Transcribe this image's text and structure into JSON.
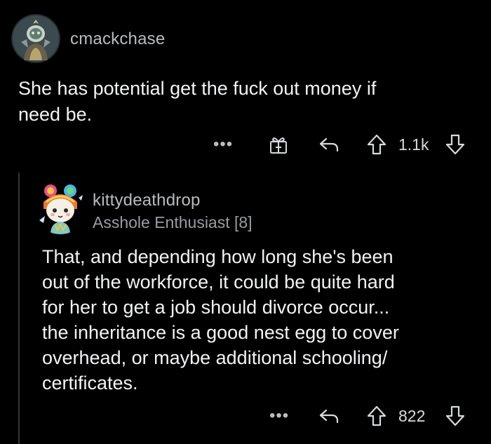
{
  "top_comment": {
    "username": "cmackchase",
    "body": "She has potential get the fuck out money if\nneed be.",
    "more_label": "•••",
    "vote_count": "1.1k"
  },
  "reply": {
    "username": "kittydeathdrop",
    "flair": "Asshole Enthusiast [8]",
    "body": "That, and depending how long she's been\nout of the workforce, it could be quite hard\nfor her to get a job should divorce occur...\nthe inheritance is a good nest egg to cover\noverhead, or maybe additional schooling/\ncertificates.",
    "more_label": "•••",
    "vote_count": "822"
  },
  "colors": {
    "background": "#000000",
    "text": "#f2f3f5",
    "muted": "#b9bbbe",
    "icon": "#d7dadc",
    "thread_line": "#343536"
  }
}
